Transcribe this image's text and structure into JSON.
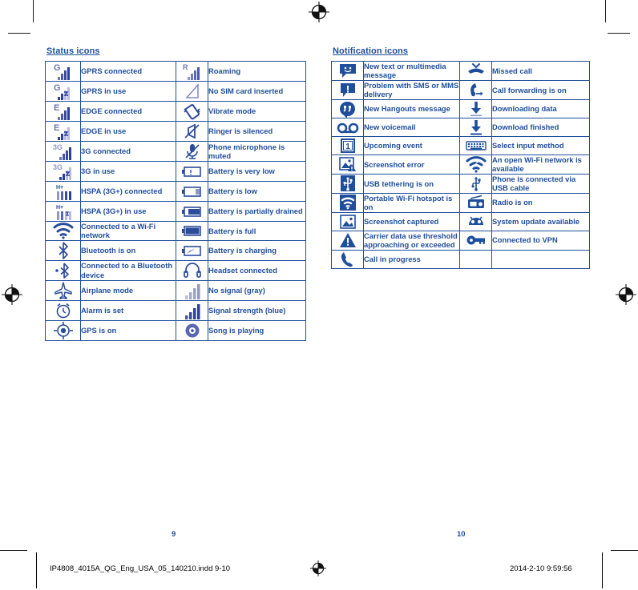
{
  "document": {
    "left_page_number": "9",
    "right_page_number": "10",
    "footer_filename": "IP4808_4015A_QG_Eng_USA_05_140210.indd   9-10",
    "footer_timestamp": "2014-2-10   9:59:56"
  },
  "colors": {
    "ink_blue": "#1f4e9c",
    "icon_fill_light": "#8f96c8",
    "icon_fill_dark": "#2b4b9b",
    "border": "#1f4e9c",
    "gray_signal": "#b9bdd6"
  },
  "status_section": {
    "heading": "Status icons",
    "rows": [
      {
        "left": {
          "icon": "gprs-connected-icon",
          "label": "GPRS connected"
        },
        "right": {
          "icon": "roaming-icon",
          "label": "Roaming"
        }
      },
      {
        "left": {
          "icon": "gprs-in-use-icon",
          "label": "GPRS in use"
        },
        "right": {
          "icon": "no-sim-card-icon",
          "label": "No SIM card inserted"
        }
      },
      {
        "left": {
          "icon": "edge-connected-icon",
          "label": "EDGE connected"
        },
        "right": {
          "icon": "vibrate-mode-icon",
          "label": "Vibrate mode"
        }
      },
      {
        "left": {
          "icon": "edge-in-use-icon",
          "label": "EDGE in use"
        },
        "right": {
          "icon": "ringer-silenced-icon",
          "label": "Ringer is silenced"
        }
      },
      {
        "left": {
          "icon": "3g-connected-icon",
          "label": "3G connected"
        },
        "right": {
          "icon": "microphone-muted-icon",
          "label": "Phone microphone is muted"
        }
      },
      {
        "left": {
          "icon": "3g-in-use-icon",
          "label": "3G in use"
        },
        "right": {
          "icon": "battery-very-low-icon",
          "label": "Battery is very low"
        }
      },
      {
        "left": {
          "icon": "hspa-connected-icon",
          "label": "HSPA (3G+) connected"
        },
        "right": {
          "icon": "battery-low-icon",
          "label": "Battery is low"
        }
      },
      {
        "left": {
          "icon": "hspa-in-use-icon",
          "label": "HSPA (3G+) in use"
        },
        "right": {
          "icon": "battery-partially-drained-icon",
          "label": "Battery is partially drained"
        }
      },
      {
        "left": {
          "icon": "wifi-connected-icon",
          "label": "Connected to a Wi-Fi network"
        },
        "right": {
          "icon": "battery-full-icon",
          "label": "Battery is full"
        }
      },
      {
        "left": {
          "icon": "bluetooth-on-icon",
          "label": "Bluetooth is on"
        },
        "right": {
          "icon": "battery-charging-icon",
          "label": "Battery is charging"
        }
      },
      {
        "left": {
          "icon": "bluetooth-connected-icon",
          "label": "Connected to a Bluetooth device"
        },
        "right": {
          "icon": "headset-connected-icon",
          "label": "Headset connected"
        }
      },
      {
        "left": {
          "icon": "airplane-mode-icon",
          "label": "Airplane mode"
        },
        "right": {
          "icon": "no-signal-gray-icon",
          "label": "No signal (gray)"
        }
      },
      {
        "left": {
          "icon": "alarm-set-icon",
          "label": "Alarm is set"
        },
        "right": {
          "icon": "signal-strength-blue-icon",
          "label": "Signal strength (blue)"
        }
      },
      {
        "left": {
          "icon": "gps-on-icon",
          "label": "GPS is on"
        },
        "right": {
          "icon": "song-playing-icon",
          "label": "Song is playing"
        }
      }
    ]
  },
  "notification_section": {
    "heading": "Notification icons",
    "rows": [
      {
        "left": {
          "icon": "new-message-icon",
          "label": "New text or multimedia message"
        },
        "right": {
          "icon": "missed-call-icon",
          "label": "Missed call"
        }
      },
      {
        "left": {
          "icon": "message-problem-icon",
          "label": "Problem with SMS or MMS delivery"
        },
        "right": {
          "icon": "call-forwarding-icon",
          "label": "Call forwarding is on"
        }
      },
      {
        "left": {
          "icon": "hangouts-message-icon",
          "label": "New Hangouts message"
        },
        "right": {
          "icon": "downloading-data-icon",
          "label": "Downloading data"
        }
      },
      {
        "left": {
          "icon": "voicemail-icon",
          "label": "New voicemail"
        },
        "right": {
          "icon": "download-finished-icon",
          "label": "Download finished"
        }
      },
      {
        "left": {
          "icon": "upcoming-event-icon",
          "label": "Upcoming event"
        },
        "right": {
          "icon": "select-input-method-icon",
          "label": "Select input method"
        }
      },
      {
        "left": {
          "icon": "screenshot-error-icon",
          "label": "Screenshot error"
        },
        "right": {
          "icon": "open-wifi-available-icon",
          "label": "An open Wi-Fi network is available"
        }
      },
      {
        "left": {
          "icon": "usb-tethering-icon",
          "label": "USB tethering is on"
        },
        "right": {
          "icon": "usb-connected-icon",
          "label": "Phone is connected via USB cable"
        }
      },
      {
        "left": {
          "icon": "wifi-hotspot-icon",
          "label": "Portable Wi-Fi hotspot is on"
        },
        "right": {
          "icon": "radio-on-icon",
          "label": "Radio is on"
        }
      },
      {
        "left": {
          "icon": "screenshot-captured-icon",
          "label": "Screenshot captured"
        },
        "right": {
          "icon": "system-update-icon",
          "label": "System update available"
        }
      },
      {
        "left": {
          "icon": "carrier-data-warning-icon",
          "label": "Carrier data use threshold approaching or exceeded"
        },
        "right": {
          "icon": "vpn-connected-icon",
          "label": "Connected to VPN"
        }
      },
      {
        "left": {
          "icon": "call-in-progress-icon",
          "label": "Call in progress"
        },
        "right": {
          "icon": "",
          "label": ""
        }
      }
    ]
  }
}
